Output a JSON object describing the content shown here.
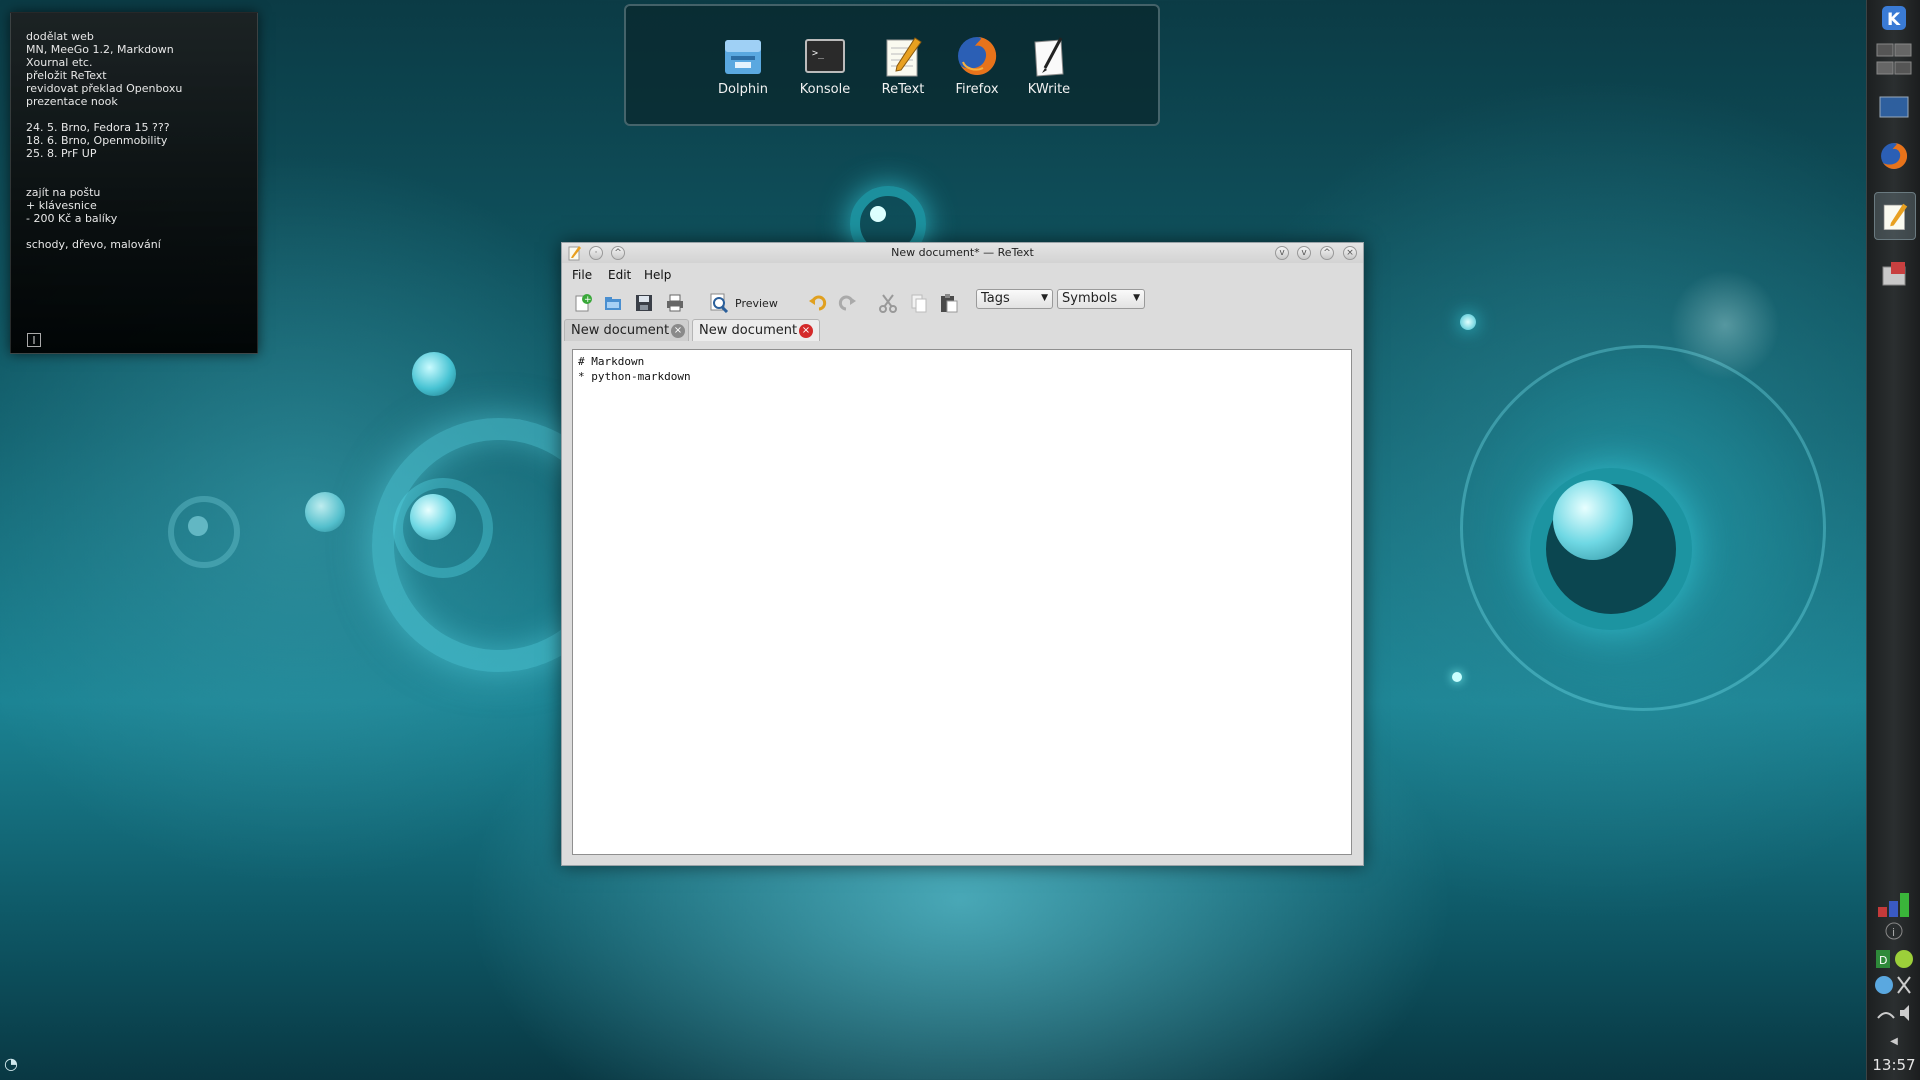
{
  "note": {
    "lines": [
      "dodělat web",
      "MN, MeeGo 1.2, Markdown",
      "Xournal etc.",
      "přeložit ReText",
      "revidovat překlad Openboxu",
      "prezentace nook",
      "",
      "24. 5. Brno, Fedora 15 ???",
      "18. 6. Brno, Openmobility",
      "25. 8. PrF UP",
      "",
      "",
      "zajít na poštu",
      "+ klávesnice",
      "- 200 Kč a balíky",
      "",
      "schody, dřevo, malování"
    ]
  },
  "launcher": {
    "items": [
      {
        "label": "Dolphin",
        "icon": "folder-icon"
      },
      {
        "label": "Konsole",
        "icon": "terminal-icon"
      },
      {
        "label": "ReText",
        "icon": "notepad-pencil-icon"
      },
      {
        "label": "Firefox",
        "icon": "firefox-icon"
      },
      {
        "label": "KWrite",
        "icon": "paper-pen-icon"
      }
    ]
  },
  "window": {
    "title": "New document* — ReText",
    "menu": [
      "File",
      "Edit",
      "Help"
    ],
    "toolbar": {
      "preview_label": "Preview",
      "tags_value": "Tags",
      "symbols_value": "Symbols"
    },
    "tabs": [
      {
        "label": "New document",
        "active": false
      },
      {
        "label": "New document",
        "active": true
      }
    ],
    "editor_lines": [
      "# Markdown",
      "* python-markdown"
    ]
  },
  "panel": {
    "clock": "13:57"
  },
  "colors": {
    "accent": "#1b8393",
    "tab_close_active": "#d42a2a",
    "tab_close_inactive": "#8a8a8a"
  }
}
